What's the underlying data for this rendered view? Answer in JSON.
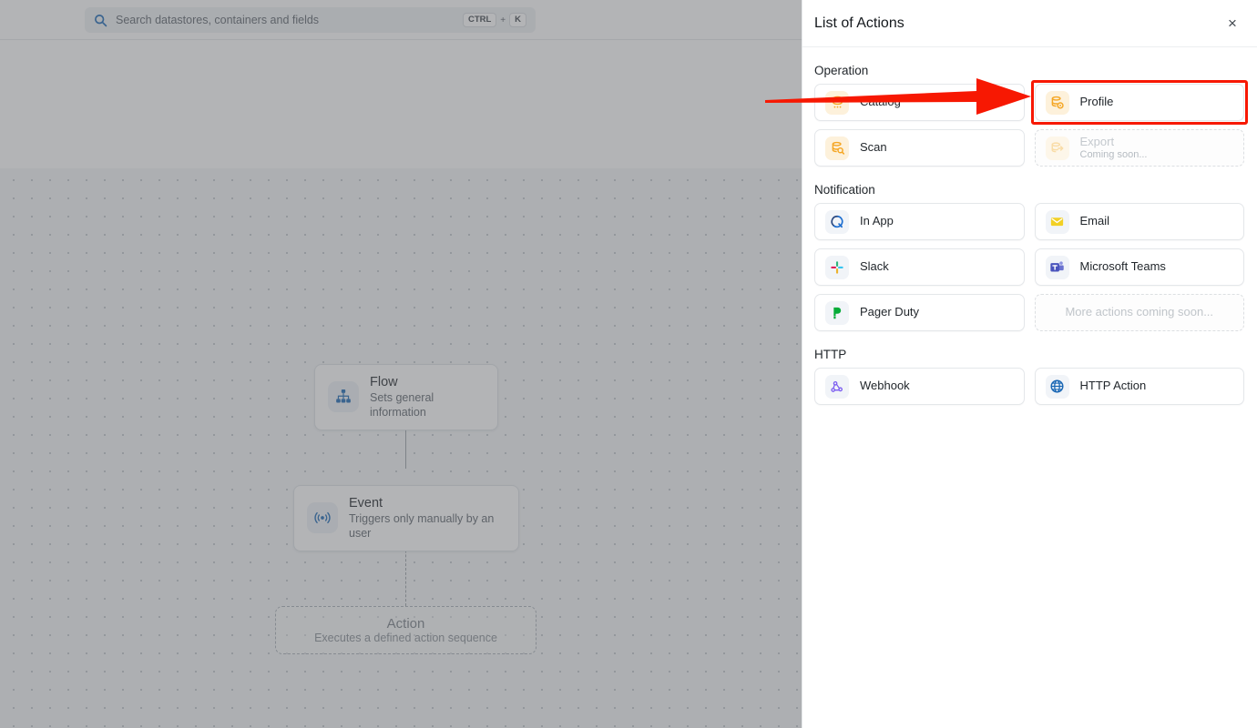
{
  "app": {
    "search": {
      "placeholder": "Search datastores, containers and fields",
      "icon": "search-icon",
      "shortcut_key1": "CTRL",
      "shortcut_plus": "+",
      "shortcut_key2": "K"
    },
    "flow": {
      "nodes": [
        {
          "id": "flow",
          "icon": "hierarchy-icon",
          "title": "Flow",
          "subtitle": "Sets general information",
          "state": "filled"
        },
        {
          "id": "event",
          "icon": "broadcast-icon",
          "title": "Event",
          "subtitle": "Triggers only manually by an user",
          "state": "filled"
        },
        {
          "id": "action",
          "icon": "",
          "title": "Action",
          "subtitle": "Executes a defined action sequence",
          "state": "placeholder"
        }
      ]
    }
  },
  "panel": {
    "title": "List of Actions",
    "close_label": "×",
    "sections": [
      {
        "id": "operation",
        "title": "Operation",
        "items": [
          {
            "label": "Catalog",
            "icon": "database-catalog-icon",
            "sub": "",
            "state": "enabled",
            "icon_bg": "amber"
          },
          {
            "label": "Profile",
            "icon": "database-profile-icon",
            "sub": "",
            "state": "highlighted",
            "icon_bg": "amber"
          },
          {
            "label": "Scan",
            "icon": "database-scan-icon",
            "sub": "",
            "state": "enabled",
            "icon_bg": "amber"
          },
          {
            "label": "Export",
            "icon": "database-export-icon",
            "sub": "Coming soon...",
            "state": "disabled",
            "icon_bg": "amber-mute"
          }
        ]
      },
      {
        "id": "notification",
        "title": "Notification",
        "items": [
          {
            "label": "In App",
            "icon": "in-app-icon",
            "sub": "",
            "state": "enabled",
            "icon_bg": "gray"
          },
          {
            "label": "Email",
            "icon": "email-icon",
            "sub": "",
            "state": "enabled",
            "icon_bg": "gray"
          },
          {
            "label": "Slack",
            "icon": "slack-icon",
            "sub": "",
            "state": "enabled",
            "icon_bg": "gray"
          },
          {
            "label": "Microsoft Teams",
            "icon": "microsoft-teams-icon",
            "sub": "",
            "state": "enabled",
            "icon_bg": "gray"
          },
          {
            "label": "Pager Duty",
            "icon": "pagerduty-icon",
            "sub": "",
            "state": "enabled",
            "icon_bg": "gray"
          },
          {
            "label": "More actions coming soon...",
            "icon": "",
            "sub": "",
            "state": "ghost",
            "icon_bg": ""
          }
        ]
      },
      {
        "id": "http",
        "title": "HTTP",
        "items": [
          {
            "label": "Webhook",
            "icon": "webhook-icon",
            "sub": "",
            "state": "enabled",
            "icon_bg": "gray"
          },
          {
            "label": "HTTP Action",
            "icon": "globe-icon",
            "sub": "",
            "state": "enabled",
            "icon_bg": "gray"
          }
        ]
      }
    ]
  },
  "annotation": {
    "arrow": {
      "name": "red-pointer-arrow",
      "color": "#f71802",
      "points_to": "Profile"
    },
    "highlight": {
      "name": "profile-highlight-box",
      "color": "#f71802"
    }
  },
  "colors": {
    "accent_amber": "#f5a623",
    "accent_blue": "#1866b4",
    "annotation_red": "#f71802",
    "panel_bg": "#ffffff",
    "canvas_bg": "#f4f6f8"
  }
}
